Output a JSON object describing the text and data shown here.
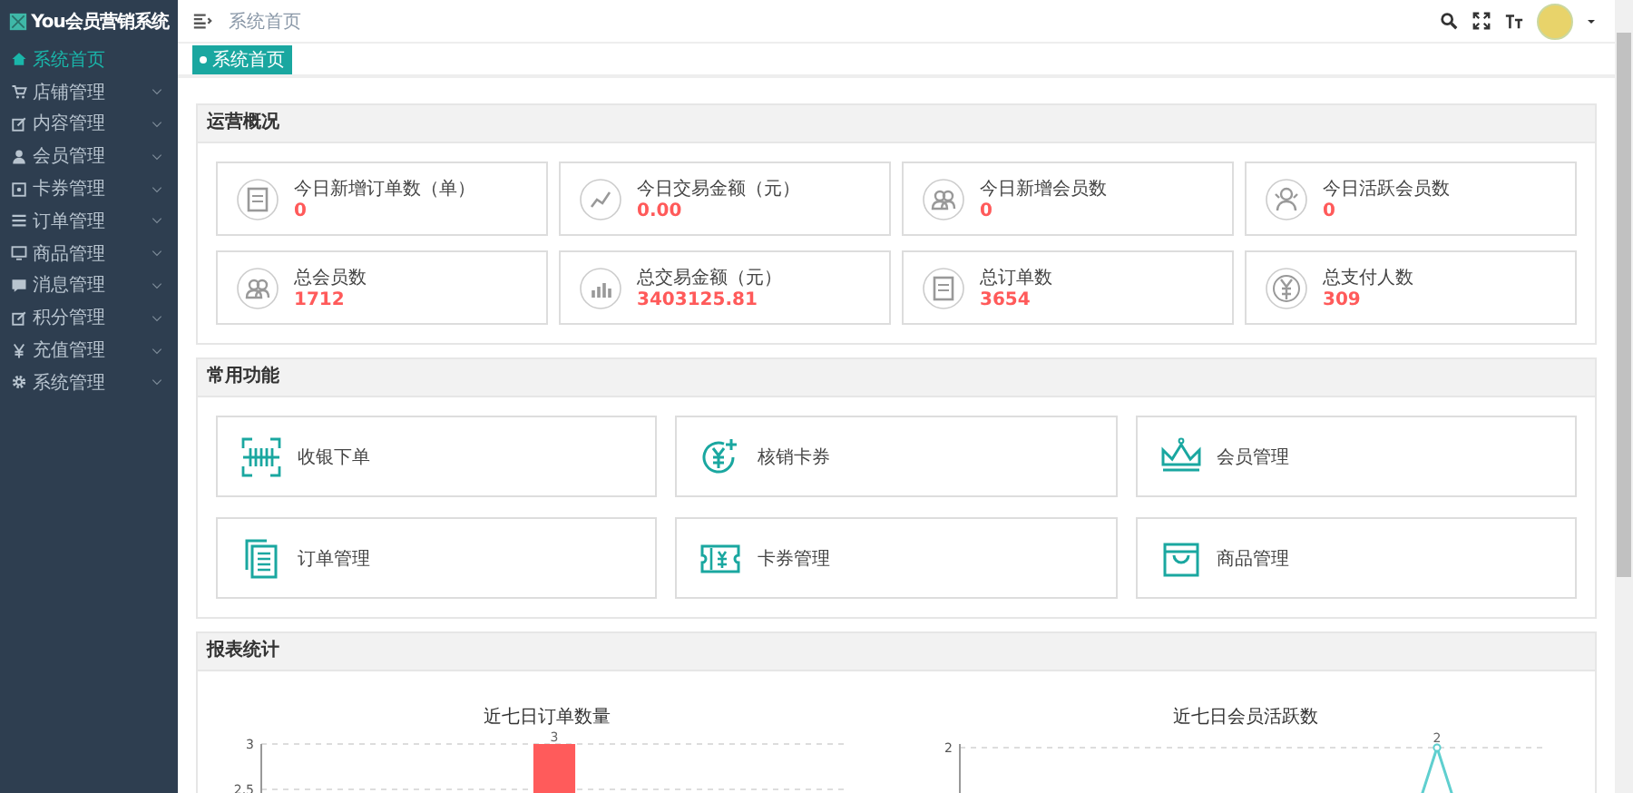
{
  "sidebar": {
    "title": "You会员营销系统",
    "items": [
      {
        "label": "系统首页",
        "selected": true,
        "expandable": false
      },
      {
        "label": "店铺管理",
        "selected": false,
        "expandable": true
      },
      {
        "label": "内容管理",
        "selected": false,
        "expandable": true
      },
      {
        "label": "会员管理",
        "selected": false,
        "expandable": true
      },
      {
        "label": "卡券管理",
        "selected": false,
        "expandable": true
      },
      {
        "label": "订单管理",
        "selected": false,
        "expandable": true
      },
      {
        "label": "商品管理",
        "selected": false,
        "expandable": true
      },
      {
        "label": "消息管理",
        "selected": false,
        "expandable": true
      },
      {
        "label": "积分管理",
        "selected": false,
        "expandable": true
      },
      {
        "label": "充值管理",
        "selected": false,
        "expandable": true
      },
      {
        "label": "系统管理",
        "selected": false,
        "expandable": true
      }
    ]
  },
  "header": {
    "breadcrumb": "系统首页"
  },
  "tabs": [
    {
      "label": "系统首页",
      "selected": true
    }
  ],
  "overview": {
    "title": "运营概况",
    "stats": [
      {
        "label": "今日新增订单数（单）",
        "value": "0"
      },
      {
        "label": "今日交易金额（元）",
        "value": "0.00"
      },
      {
        "label": "今日新增会员数",
        "value": "0"
      },
      {
        "label": "今日活跃会员数",
        "value": "0"
      },
      {
        "label": "总会员数",
        "value": "1712"
      },
      {
        "label": "总交易金额（元）",
        "value": "3403125.81"
      },
      {
        "label": "总订单数",
        "value": "3654"
      },
      {
        "label": "总支付人数",
        "value": "309"
      }
    ]
  },
  "functions": {
    "title": "常用功能",
    "items": [
      {
        "label": "收银下单"
      },
      {
        "label": "核销卡券"
      },
      {
        "label": "会员管理"
      },
      {
        "label": "订单管理"
      },
      {
        "label": "卡券管理"
      },
      {
        "label": "商品管理"
      }
    ]
  },
  "reports": {
    "title": "报表统计",
    "order_chart": {
      "chart_data": {
        "type": "bar",
        "title": "近七日订单数量",
        "ylim": [
          2.4,
          3
        ],
        "yticks": [
          2.5,
          3
        ],
        "data_labels": true,
        "series": [
          {
            "color": "#ff5b5b",
            "values": [
              null,
              null,
              null,
              3,
              null,
              null,
              null
            ]
          }
        ]
      }
    },
    "member_chart": {
      "title": "近七日会员活跃数",
      "y_tick": "2",
      "point_label": "2"
    }
  }
}
